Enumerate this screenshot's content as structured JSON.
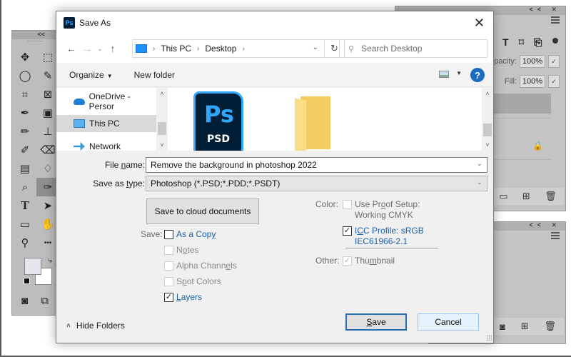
{
  "photoshop": {
    "tools_panel": {
      "collapse_label": "<<",
      "tools": [
        {
          "name": "move-tool",
          "glyph": "✥"
        },
        {
          "name": "marquee-tool",
          "glyph": "⬚"
        },
        {
          "name": "lasso-tool",
          "glyph": "◯"
        },
        {
          "name": "quick-selection-tool",
          "glyph": "✎"
        },
        {
          "name": "crop-tool",
          "glyph": "⌗"
        },
        {
          "name": "frame-tool",
          "glyph": "⊠"
        },
        {
          "name": "eyedropper-tool",
          "glyph": "✒"
        },
        {
          "name": "spot-healing-tool",
          "glyph": "▣"
        },
        {
          "name": "brush-tool",
          "glyph": "✏"
        },
        {
          "name": "clone-stamp-tool",
          "glyph": "⊥"
        },
        {
          "name": "history-brush-tool",
          "glyph": "✐"
        },
        {
          "name": "eraser-tool",
          "glyph": "⌫"
        },
        {
          "name": "gradient-tool",
          "glyph": "▤"
        },
        {
          "name": "blur-tool",
          "glyph": "♢"
        },
        {
          "name": "dodge-tool",
          "glyph": "⌕"
        },
        {
          "name": "pen-tool",
          "glyph": "✑"
        },
        {
          "name": "type-tool",
          "glyph": "T"
        },
        {
          "name": "path-selection-tool",
          "glyph": "➤"
        },
        {
          "name": "rectangle-tool",
          "glyph": "▭"
        },
        {
          "name": "hand-tool",
          "glyph": "✋"
        },
        {
          "name": "zoom-tool",
          "glyph": "⚲"
        },
        {
          "name": "more-tools",
          "glyph": "•••"
        }
      ],
      "swap_glyph": "⤷",
      "quick_mask_glyph": "◙",
      "screen_mode_glyph": "⧉"
    },
    "layers_panel": {
      "header_controls": "<< ✕",
      "icons": [
        "T",
        "⌑",
        "⎘"
      ],
      "opacity_label": "Opacity:",
      "opacity_value": "100%",
      "fill_label": "Fill:",
      "fill_value": "100%",
      "dropdown_glyph": "✓",
      "lock_glyph": "🔒",
      "footer_icons": [
        "▭",
        "⊞",
        "🗑"
      ]
    },
    "lower_panel": {
      "header_controls": "<< ✕",
      "footer_icons": [
        "◙",
        "⊞",
        "🗑"
      ]
    }
  },
  "dialog": {
    "app_icon": "Ps",
    "title": "Save As",
    "close_glyph": "✕",
    "nav": {
      "back_glyph": "←",
      "forward_glyph": "→",
      "recent_glyph": "⌄",
      "up_glyph": "↑",
      "breadcrumbs": [
        "This PC",
        "Desktop"
      ],
      "crumb_sep": "›",
      "address_dropdown_glyph": "⌄",
      "refresh_glyph": "↻",
      "search_placeholder": "Search Desktop",
      "search_glyph": "⚲"
    },
    "command_bar": {
      "organize_label": "Organize",
      "organize_caret": "▼",
      "new_folder_label": "New folder",
      "view_dropdown_glyph": "▼",
      "help_glyph": "?"
    },
    "nav_pane": {
      "items": [
        {
          "label": "OneDrive - Persor",
          "icon": "cloud-icon",
          "selected": false
        },
        {
          "label": "This PC",
          "icon": "computer-icon",
          "selected": true
        },
        {
          "label": "Network",
          "icon": "network-icon",
          "selected": false
        }
      ],
      "scroll_up": "˄",
      "scroll_down": "˅"
    },
    "files": [
      {
        "type": "psd",
        "icon_text": "Ps",
        "ext": "PSD"
      },
      {
        "type": "folder"
      }
    ],
    "file_name": {
      "label_pre": "File ",
      "label_u": "n",
      "label_post": "ame:",
      "value": "Remove the background in photoshop 2022",
      "dropdown_glyph": "⌄"
    },
    "save_as_type": {
      "label_pre": "Save as ",
      "label_u": "t",
      "label_post": "ype:",
      "value": "Photoshop (*.PSD;*.PDD;*.PSDT)",
      "dropdown_glyph": "⌄"
    },
    "cloud_button_label": "Save to cloud documents",
    "save_options": {
      "label": "Save:",
      "items": [
        {
          "pre": "As a Cop",
          "u": "y",
          "post": "",
          "checked": false,
          "enabled": true
        },
        {
          "pre": "N",
          "u": "o",
          "post": "tes",
          "checked": false,
          "enabled": false
        },
        {
          "pre": "Alpha Chann",
          "u": "e",
          "post": "ls",
          "checked": false,
          "enabled": false
        },
        {
          "pre": "S",
          "u": "p",
          "post": "ot Colors",
          "checked": false,
          "enabled": false
        },
        {
          "pre": "",
          "u": "L",
          "post": "ayers",
          "checked": true,
          "enabled": true
        }
      ]
    },
    "color_options": {
      "label": "Color:",
      "proof_setup": {
        "pre": "Use Pr",
        "u": "o",
        "post": "of Setup:",
        "line2": "Working CMYK",
        "checked": false,
        "enabled": false
      },
      "icc_profile": {
        "pre": "I",
        "u": "C",
        "post": "C Profile:  sRGB",
        "line2": "IEC61966-2.1",
        "checked": true,
        "enabled": true
      }
    },
    "other_options": {
      "label": "Other:",
      "thumbnail": {
        "pre": "Thu",
        "u": "m",
        "post": "bnail",
        "checked": true,
        "enabled": false
      }
    },
    "hide_folders": {
      "glyph": "˄",
      "label": "Hide Folders"
    },
    "save_button": {
      "u": "S",
      "post": "ave"
    },
    "cancel_button_label": "Cancel",
    "check_glyph": "✓"
  }
}
